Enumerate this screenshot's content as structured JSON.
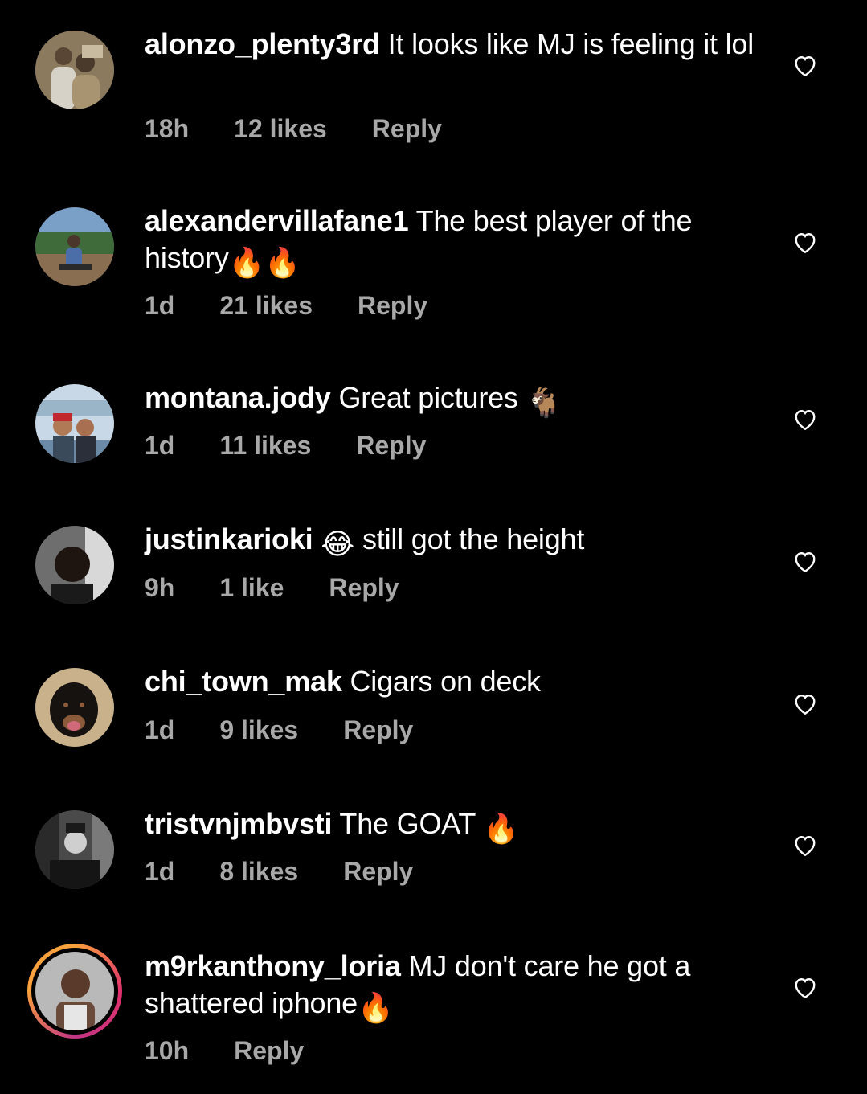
{
  "comments": [
    {
      "username": "alonzo_plenty3rd",
      "text": "It looks like MJ is feeling it lol",
      "emoji": "",
      "time": "18h",
      "likes": "12 likes",
      "reply": "Reply",
      "avatar": "avatar-photo-couple"
    },
    {
      "username": "alexandervillafane1",
      "text": "The best player of the history",
      "emoji": "🔥🔥",
      "time": "1d",
      "likes": "21 likes",
      "reply": "Reply",
      "avatar": "avatar-photo-outdoor"
    },
    {
      "username": "montana.jody",
      "text": "Great pictures",
      "emoji": "🐐",
      "time": "1d",
      "likes": "11 likes",
      "reply": "Reply",
      "avatar": "avatar-photo-selfie"
    },
    {
      "username": "justinkarioki",
      "text": "still got the height",
      "emoji": "😂",
      "time": "9h",
      "likes": "1 like",
      "reply": "Reply",
      "avatar": "avatar-photo-man"
    },
    {
      "username": "chi_town_mak",
      "text": "Cigars on deck",
      "emoji": "",
      "time": "1d",
      "likes": "9 likes",
      "reply": "Reply",
      "avatar": "avatar-photo-dog"
    },
    {
      "username": "tristvnjmbvsti",
      "text": "The GOAT",
      "emoji": "🔥",
      "time": "1d",
      "likes": "8 likes",
      "reply": "Reply",
      "avatar": "avatar-photo-bw"
    },
    {
      "username": "m9rkanthony_loria",
      "text": "MJ don't care he got a shattered iphone",
      "emoji": "🔥",
      "time": "10h",
      "likes": "",
      "reply": "Reply",
      "avatar": "avatar-photo-story"
    }
  ],
  "colors": {
    "background": "#000000",
    "text": "#ffffff",
    "meta": "#a8a8a8",
    "story_ring_start": "#f9a13c",
    "story_ring_end": "#c13584"
  },
  "icons": {
    "like": "heart-outline-icon"
  }
}
